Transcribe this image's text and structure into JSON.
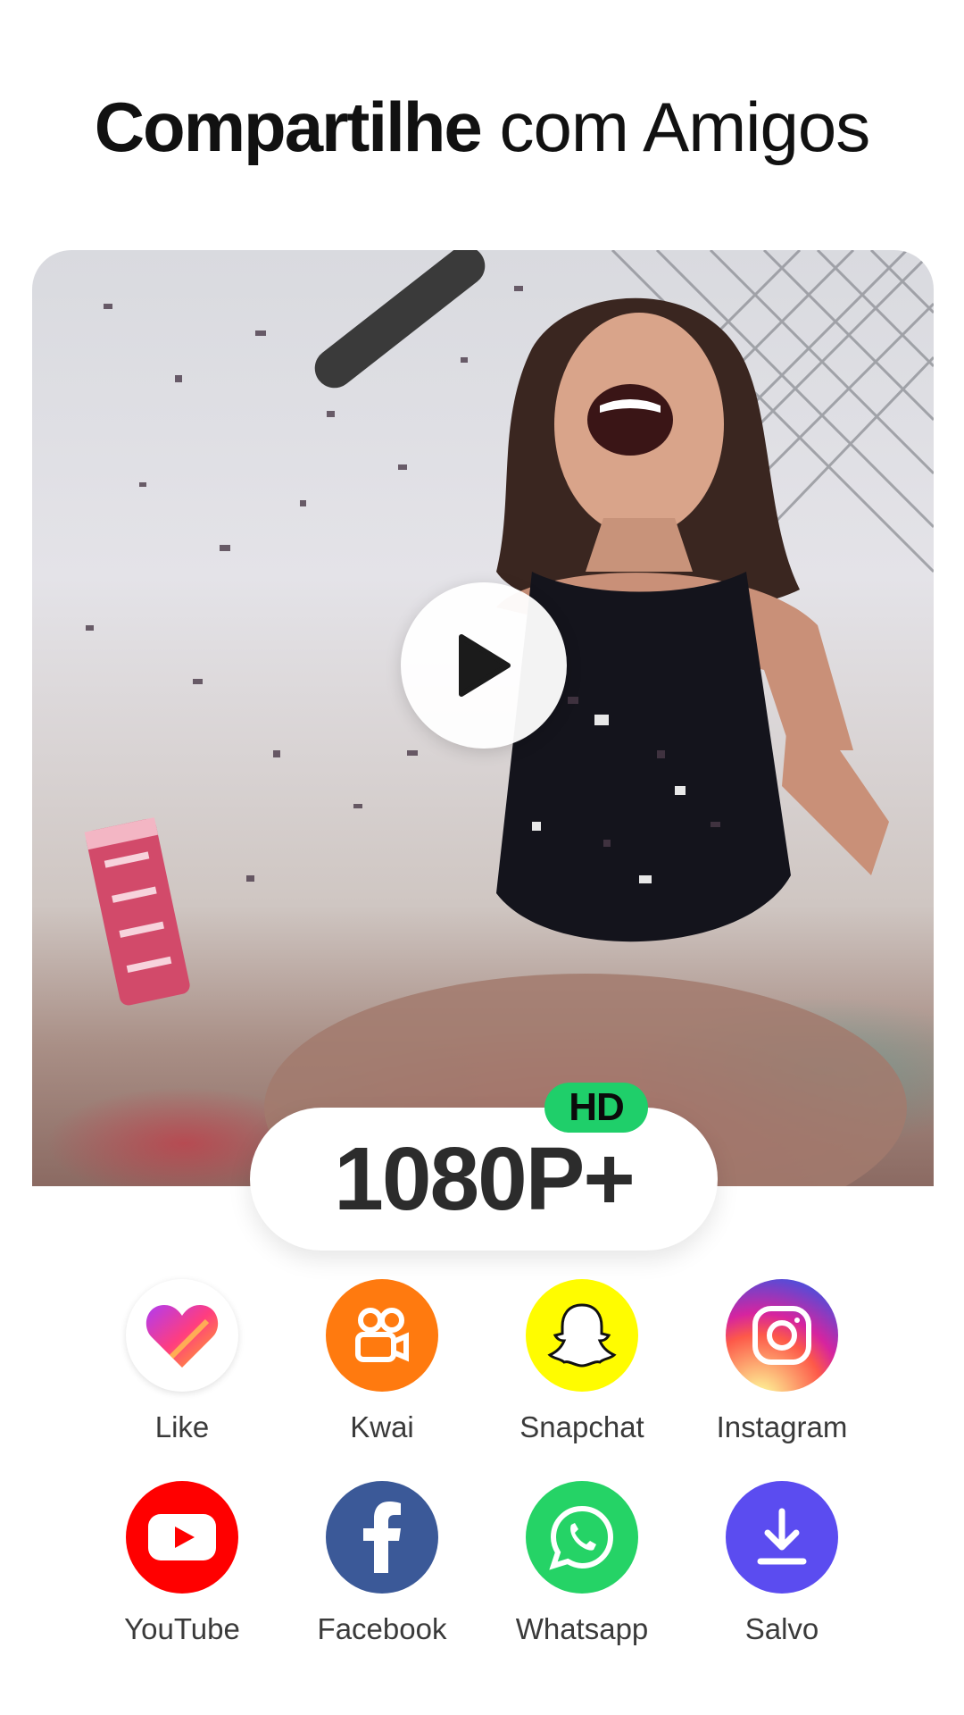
{
  "header": {
    "title_bold": "Compartilhe",
    "title_light": "com Amigos"
  },
  "preview": {
    "resolution": "1080P+",
    "badge": "HD",
    "play_icon": "play-icon"
  },
  "share": [
    {
      "label": "Like",
      "icon": "like-heart-icon",
      "color": "#ffffff"
    },
    {
      "label": "Kwai",
      "icon": "kwai-camera-icon",
      "color": "#ff7a0f"
    },
    {
      "label": "Snapchat",
      "icon": "snapchat-ghost-icon",
      "color": "#fffc00"
    },
    {
      "label": "Instagram",
      "icon": "instagram-camera-icon",
      "color": "#d6249f"
    },
    {
      "label": "YouTube",
      "icon": "youtube-play-icon",
      "color": "#ff0000"
    },
    {
      "label": "Facebook",
      "icon": "facebook-f-icon",
      "color": "#3b5998"
    },
    {
      "label": "Whatsapp",
      "icon": "whatsapp-phone-icon",
      "color": "#25d366"
    },
    {
      "label": "Salvo",
      "icon": "download-icon",
      "color": "#5b4cf0"
    }
  ]
}
